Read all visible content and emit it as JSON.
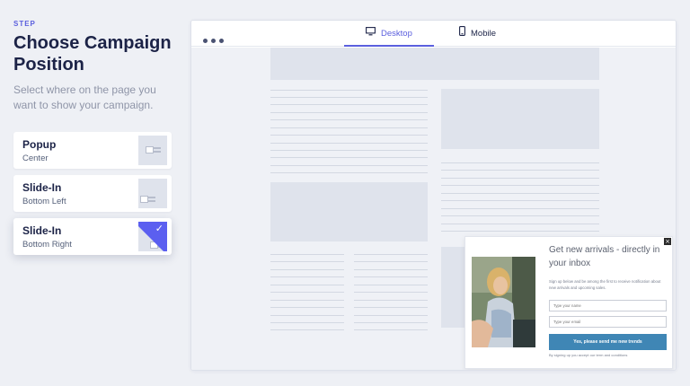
{
  "sidebar": {
    "step_label": "STEP",
    "title": "Choose Campaign Position",
    "subtitle": "Select where on the page you want to show your campaign.",
    "options": [
      {
        "title": "Popup",
        "subtitle": "Center",
        "selected": false
      },
      {
        "title": "Slide-In",
        "subtitle": "Bottom Left",
        "selected": false
      },
      {
        "title": "Slide-In",
        "subtitle": "Bottom Right",
        "selected": true
      }
    ],
    "check_glyph": "✓"
  },
  "preview": {
    "tabs": [
      {
        "label": "Desktop",
        "icon": "desktop-icon",
        "active": true
      },
      {
        "label": "Mobile",
        "icon": "mobile-icon",
        "active": false
      }
    ],
    "popup": {
      "close_glyph": "×",
      "title": "Get new arrivals - directly in your inbox",
      "text": "Sign up below and be among the first to receive notification about new arrivals and upcoming sales.",
      "name_placeholder": "Type your name",
      "email_placeholder": "Type your email",
      "button_label": "Yes, please send me new trends",
      "note": "By signing up you accept our term and conditions"
    }
  },
  "colors": {
    "accent": "#5b5fde",
    "popup_button": "#3f86b5",
    "placeholder_block": "#dfe3ec"
  }
}
